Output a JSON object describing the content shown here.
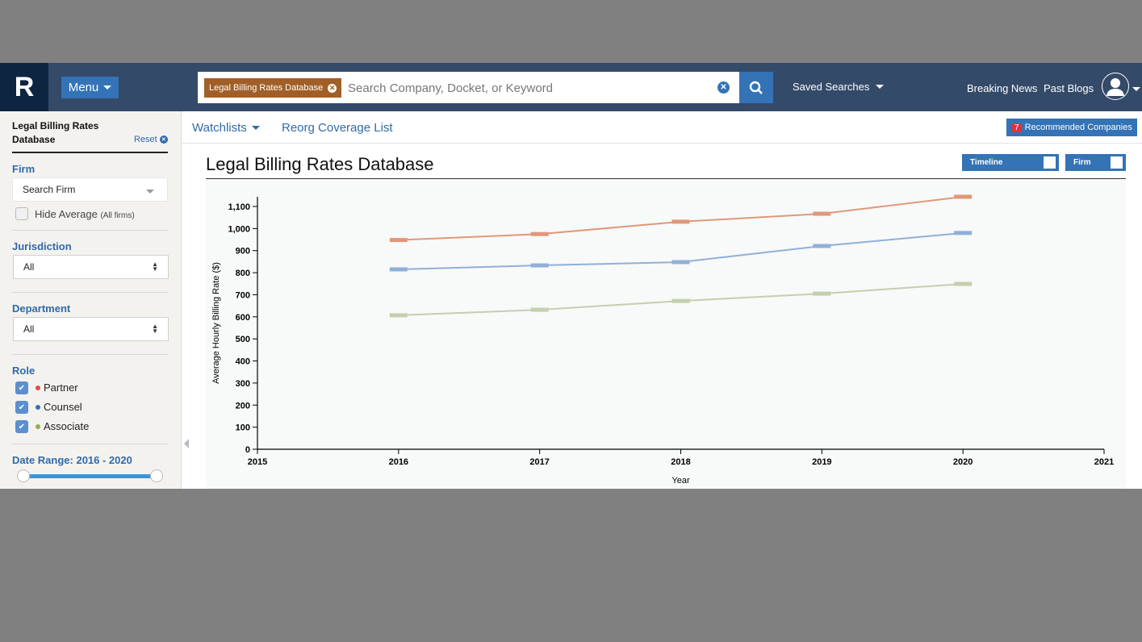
{
  "header": {
    "logo": "R",
    "menu_label": "Menu",
    "search_chip": "Legal Billing Rates Database",
    "search_placeholder": "Search Company, Docket, or Keyword",
    "saved_searches": "Saved Searches",
    "breaking_news": "Breaking News",
    "past_blogs": "Past Blogs"
  },
  "subnav": {
    "watchlists": "Watchlists",
    "reorg_coverage": "Reorg Coverage List",
    "recommended_count": "7",
    "recommended_label": "Recommended Companies"
  },
  "sidebar": {
    "title": "Legal Billing Rates Database",
    "reset": "Reset",
    "firm_label": "Firm",
    "firm_placeholder": "Search Firm",
    "hide_average": "Hide Average",
    "hide_average_note": "(All firms)",
    "hide_average_checked": false,
    "jurisdiction_label": "Jurisdiction",
    "jurisdiction_value": "All",
    "department_label": "Department",
    "department_value": "All",
    "role_label": "Role",
    "roles": [
      {
        "label": "Partner",
        "checked": true,
        "color": "#e04b4b"
      },
      {
        "label": "Counsel",
        "checked": true,
        "color": "#3373b6"
      },
      {
        "label": "Associate",
        "checked": true,
        "color": "#8fae5d"
      }
    ],
    "date_range_label": "Date Range: 2016 - 2020",
    "date_range": [
      2016,
      2020
    ]
  },
  "main": {
    "title": "Legal Billing Rates Database",
    "toggles": [
      {
        "label": "Timeline"
      },
      {
        "label": "Firm"
      }
    ]
  },
  "chart_data": {
    "type": "line",
    "xlabel": "Year",
    "ylabel": "Average Hourly Billing Rate ($)",
    "xlim": [
      2015,
      2021
    ],
    "ylim": [
      0,
      1150
    ],
    "xticks": [
      "2015",
      "2016",
      "2017",
      "2018",
      "2019",
      "2020",
      "2021"
    ],
    "yticks": [
      "0",
      "100",
      "200",
      "300",
      "400",
      "500",
      "600",
      "700",
      "800",
      "900",
      "1,000",
      "1,100"
    ],
    "x": [
      2016,
      2017,
      2018,
      2019,
      2020
    ],
    "grid": false,
    "series": [
      {
        "role": "Partner",
        "color": "#e09878",
        "values": [
          948,
          975,
          1031,
          1067,
          1144
        ]
      },
      {
        "role": "Counsel",
        "color": "#8fb0d8",
        "values": [
          815,
          833,
          848,
          921,
          980
        ]
      },
      {
        "role": "Associate",
        "color": "#c3d0ae",
        "values": [
          607,
          632,
          672,
          705,
          749
        ]
      }
    ]
  }
}
